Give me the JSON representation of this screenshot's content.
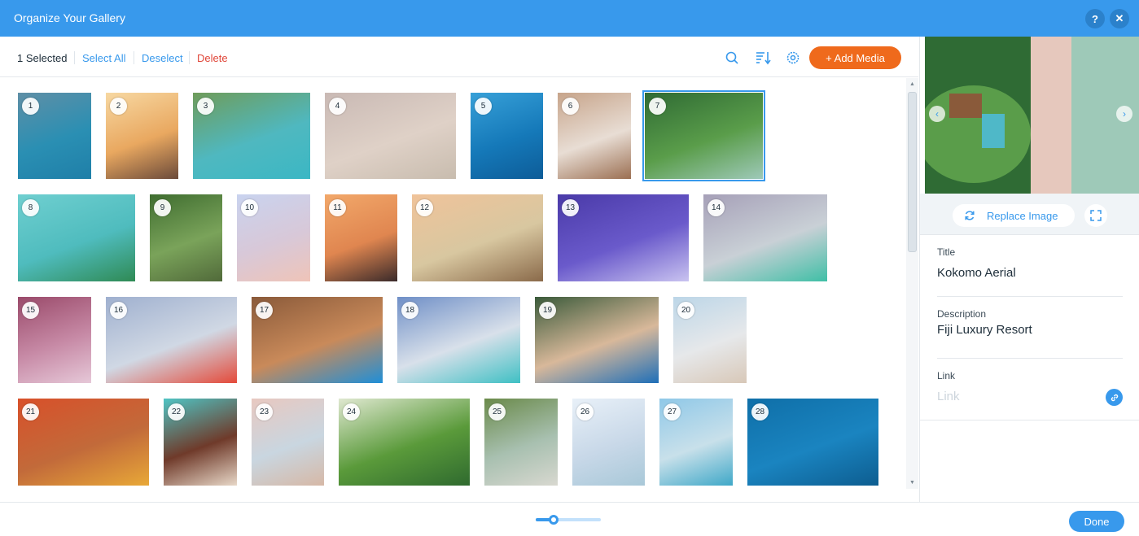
{
  "window": {
    "title": "Organize Your Gallery",
    "help_glyph": "?",
    "close_glyph": "✕"
  },
  "toolbar": {
    "selected_count": "1 Selected",
    "select_all": "Select All",
    "deselect": "Deselect",
    "delete": "Delete",
    "add_media": "+ Add Media",
    "icons": [
      "search-icon",
      "sort-icon",
      "gear-icon"
    ]
  },
  "gallery": {
    "selected_index": 7,
    "items": [
      {
        "num": "1",
        "colors": [
          "#5f8fa6",
          "#2a8fb3",
          "#1f7fa8"
        ]
      },
      {
        "num": "2",
        "colors": [
          "#f7d8a2",
          "#e9a860",
          "#6b4a3a"
        ]
      },
      {
        "num": "3",
        "colors": [
          "#6f9c5a",
          "#4fb8c0",
          "#3bb7c4"
        ]
      },
      {
        "num": "4",
        "colors": [
          "#c9b9b4",
          "#dfd1c7",
          "#c8bcae"
        ]
      },
      {
        "num": "5",
        "colors": [
          "#37a0d8",
          "#1579b9",
          "#0d5c98"
        ]
      },
      {
        "num": "6",
        "colors": [
          "#c7a48a",
          "#e8ddd4",
          "#9b6f52"
        ]
      },
      {
        "num": "7",
        "colors": [
          "#2f6b34",
          "#5a9d4a",
          "#9ec9b8"
        ]
      },
      {
        "num": "8",
        "colors": [
          "#6fcfd0",
          "#4fbcbe",
          "#2f8a54"
        ]
      },
      {
        "num": "9",
        "colors": [
          "#3f6d30",
          "#7aa35a",
          "#516a3a"
        ]
      },
      {
        "num": "10",
        "colors": [
          "#c9d3ef",
          "#d8c8d8",
          "#efc4b8"
        ]
      },
      {
        "num": "11",
        "colors": [
          "#f2a86a",
          "#e08650",
          "#3a2a2a"
        ]
      },
      {
        "num": "12",
        "colors": [
          "#f0c39a",
          "#d8c7a0",
          "#8a6a4a"
        ]
      },
      {
        "num": "13",
        "colors": [
          "#4a3aa8",
          "#6a5acb",
          "#c9c3f0"
        ]
      },
      {
        "num": "14",
        "colors": [
          "#a6a0b8",
          "#c9d0d6",
          "#3fbfa6"
        ]
      },
      {
        "num": "15",
        "colors": [
          "#9a4a6a",
          "#c78aa6",
          "#e6c8d8"
        ]
      },
      {
        "num": "16",
        "colors": [
          "#9fb0cf",
          "#d0d8e4",
          "#e44a3a"
        ]
      },
      {
        "num": "17",
        "colors": [
          "#8a5a3a",
          "#c98a5a",
          "#1f8fd8"
        ]
      },
      {
        "num": "18",
        "colors": [
          "#6f8fc7",
          "#d8e0ea",
          "#3fc0c4"
        ]
      },
      {
        "num": "19",
        "colors": [
          "#3a5a3a",
          "#d8b89a",
          "#1f6fb8"
        ]
      },
      {
        "num": "20",
        "colors": [
          "#bcd6e8",
          "#e6e8ea",
          "#d8c8b8"
        ]
      },
      {
        "num": "21",
        "colors": [
          "#d8502a",
          "#c26a3a",
          "#e8a838"
        ]
      },
      {
        "num": "22",
        "colors": [
          "#4fc4c4",
          "#6f3a2a",
          "#e8d8c8"
        ]
      },
      {
        "num": "23",
        "colors": [
          "#e8c8c0",
          "#c9d6e0",
          "#d6b8a6"
        ]
      },
      {
        "num": "24",
        "colors": [
          "#dfe8d0",
          "#5a9a3a",
          "#2f6a2f"
        ]
      },
      {
        "num": "25",
        "colors": [
          "#6a8a4a",
          "#a8c0b0",
          "#d8d8d0"
        ]
      },
      {
        "num": "26",
        "colors": [
          "#e8f0f8",
          "#c8d8e8",
          "#a8c8d8"
        ]
      },
      {
        "num": "27",
        "colors": [
          "#8fc8e8",
          "#c8e0ea",
          "#3fa8c8"
        ]
      },
      {
        "num": "28",
        "colors": [
          "#0f6fa8",
          "#1a84c0",
          "#0d5d90"
        ]
      }
    ]
  },
  "details": {
    "preview_colors": [
      "#2f6b34",
      "#5a9d4a",
      "#e6c8bd",
      "#9ec9b8"
    ],
    "prev_glyph": "‹",
    "next_glyph": "›",
    "replace_image": "Replace Image",
    "title_label": "Title",
    "title_value": "Kokomo Aerial",
    "description_label": "Description",
    "description_value": "Fiji Luxury Resort",
    "link_label": "Link",
    "link_placeholder": "Link"
  },
  "footer": {
    "zoom_fraction": 0.27,
    "done": "Done"
  },
  "colors": {
    "accent": "#3899ec",
    "add_media": "#ef6a1c",
    "delete": "#e0473a"
  }
}
